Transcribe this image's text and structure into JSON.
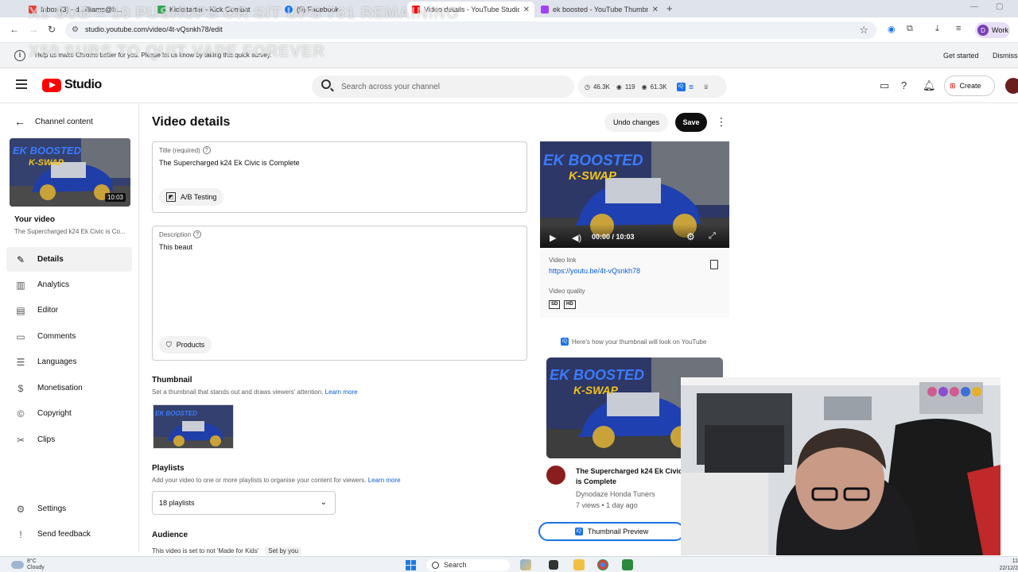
{
  "browser": {
    "tabs": [
      {
        "label": "Inbox (3) - d...illiams@h...",
        "favicon_color": "#ea4335"
      },
      {
        "label": "Kickstarter - Kick Combat",
        "favicon_color": "#34a853"
      },
      {
        "label": "(9) Facebook",
        "favicon_color": "#1877f2"
      },
      {
        "label": "Video details - YouTube Studio",
        "favicon_color": "#ff0000"
      },
      {
        "label": "ek boosted - YouTube Thumbn",
        "favicon_color": "#a142f4"
      }
    ],
    "url": "studio.youtube.com/video/4t-vQsnkh78/edit",
    "profile_label": "Work",
    "profile_initial": "D",
    "info_message": "Help us make Chrome better for you. Please let us know by taking this quick survey.",
    "info_get_started": "Get started",
    "info_dismiss": "Dismiss"
  },
  "overlay": {
    "line1": "X1 SUB = 10 PUSHUPS OR SIT UPS 761 REMAINING",
    "line2": "X50 SUBS TO QUIT VAPE FOREVER"
  },
  "header": {
    "logo_text": "Studio",
    "search_placeholder": "Search across your channel",
    "stat_views": "46.3K",
    "stat_likes": "119",
    "stat_watch": "61.3K",
    "create_label": "Create"
  },
  "sidebar": {
    "back_label": "Channel content",
    "thumb_duration": "10:03",
    "your_video": "Your video",
    "video_title": "The Supercharged k24 Ek Civic is Co...",
    "items": [
      {
        "label": "Details",
        "icon": "pencil-icon"
      },
      {
        "label": "Analytics",
        "icon": "analytics-icon"
      },
      {
        "label": "Editor",
        "icon": "editor-icon"
      },
      {
        "label": "Comments",
        "icon": "comments-icon"
      },
      {
        "label": "Languages",
        "icon": "languages-icon"
      },
      {
        "label": "Monetisation",
        "icon": "dollar-icon"
      },
      {
        "label": "Copyright",
        "icon": "copyright-icon"
      },
      {
        "label": "Clips",
        "icon": "scissors-icon"
      }
    ],
    "settings": "Settings",
    "feedback": "Send feedback"
  },
  "main": {
    "title": "Video details",
    "undo_label": "Undo changes",
    "save_label": "Save",
    "title_field_label": "Title (required)",
    "title_value": "The Supercharged k24 Ek Civic is Complete",
    "ab_testing": "A/B Testing",
    "description_label": "Description",
    "description_value": "This beaut",
    "products_label": "Products",
    "thumbnail_heading": "Thumbnail",
    "thumbnail_sub": "Set a thumbnail that stands out and draws viewers' attention.",
    "learn_more": "Learn more",
    "playlists_heading": "Playlists",
    "playlists_sub": "Add your video to one or more playlists to organise your content for viewers.",
    "playlists_value": "18 playlists",
    "audience_heading": "Audience",
    "audience_sub": "This video is set to not 'Made for Kids'",
    "audience_setby": "Set by you"
  },
  "preview": {
    "thumb_text_1": "EK BOOSTED",
    "thumb_text_2": "K-SWAP",
    "time": "00:00 / 10:03",
    "video_link_label": "Video link",
    "video_link": "https://youtu.be/4t-vQsnkh78",
    "video_quality_label": "Video quality",
    "quality_badges": [
      "SD",
      "HD"
    ],
    "how_look": "Here's how your thumbnail will look on YouTube",
    "card_title": "The Supercharged k24 Ek Civic is Complete",
    "card_channel": "Dynodaze Honda Tuners",
    "card_meta": "7 views • 1 day ago",
    "thumbnail_preview_btn": "Thumbnail Preview"
  },
  "taskbar": {
    "temp": "8°C",
    "weather": "Cloudy",
    "search": "Search",
    "time": "11",
    "date": "22/12/2"
  },
  "colors": {
    "accent": "#065fd4",
    "brand_red": "#ff0000"
  }
}
